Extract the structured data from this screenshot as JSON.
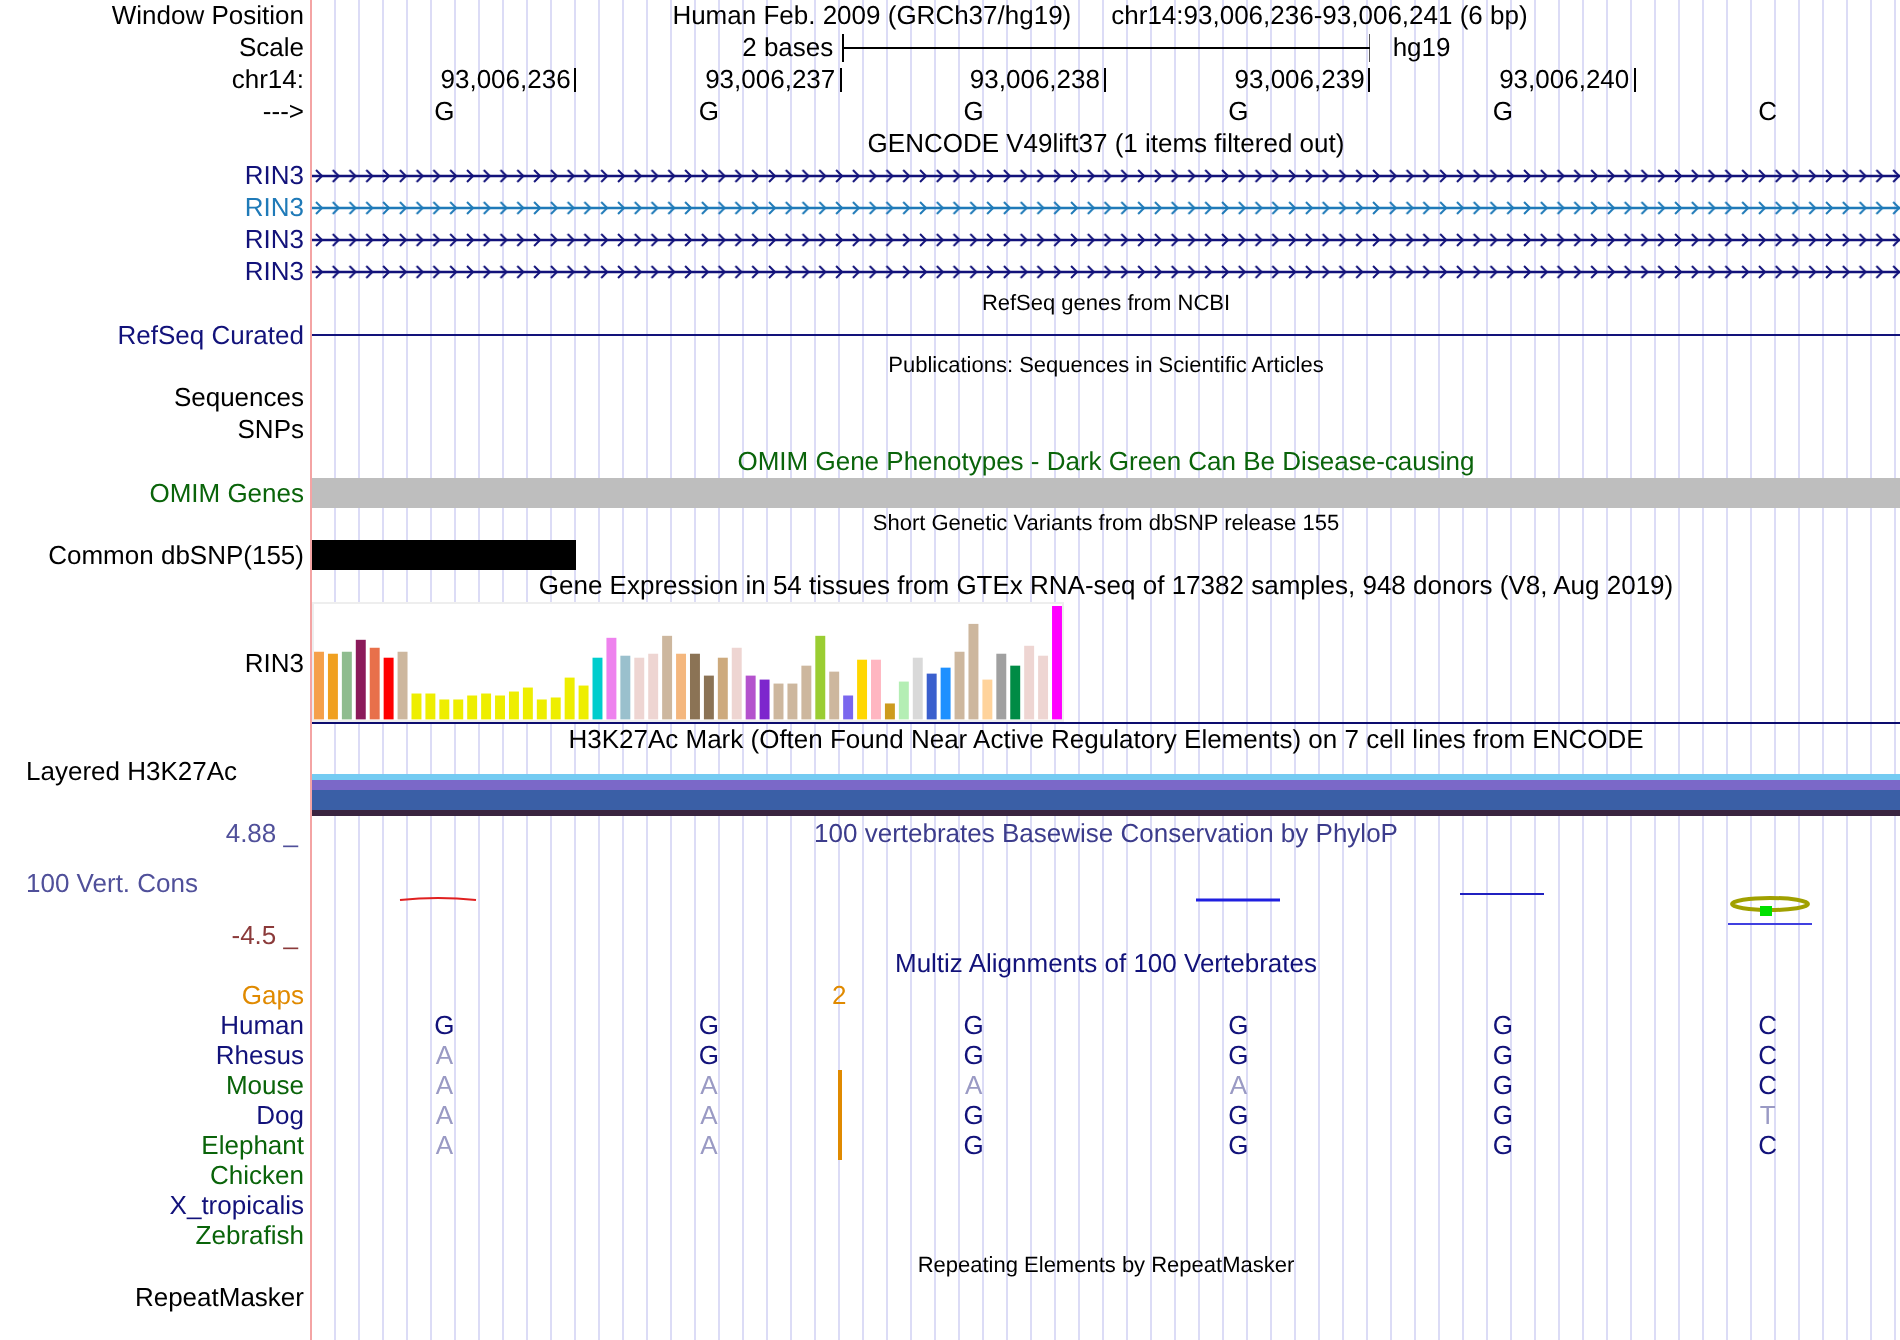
{
  "header": {
    "label": "Window Position",
    "assembly": "Human Feb. 2009 (GRCh37/hg19)",
    "position": "chr14:93,006,236-93,006,241 (6 bp)"
  },
  "scale": {
    "label": "Scale",
    "text": "2 bases",
    "assembly": "hg19"
  },
  "ruler": {
    "label": "chr14:",
    "ticks": [
      "93,006,236",
      "93,006,237",
      "93,006,238",
      "93,006,239",
      "93,006,240"
    ]
  },
  "bases": {
    "label": "--->",
    "values": [
      "G",
      "G",
      "G",
      "G",
      "G",
      "C"
    ]
  },
  "tracks": [
    {
      "kind": "title",
      "text": "GENCODE V49lift37 (1 items filtered out)",
      "color": "#000000"
    },
    {
      "kind": "gene",
      "label": "RIN3",
      "color": "#12127a"
    },
    {
      "kind": "gene",
      "label": "RIN3",
      "color": "#1f7ab8"
    },
    {
      "kind": "gene",
      "label": "RIN3",
      "color": "#12127a"
    },
    {
      "kind": "gene",
      "label": "RIN3",
      "color": "#12127a"
    },
    {
      "kind": "caption",
      "text": "RefSeq genes from NCBI"
    },
    {
      "kind": "line",
      "label": "RefSeq Curated",
      "color": "#12127a"
    },
    {
      "kind": "caption",
      "text": "Publications: Sequences in Scientific Articles"
    },
    {
      "kind": "label",
      "label": "Sequences"
    },
    {
      "kind": "label",
      "label": "SNPs"
    },
    {
      "kind": "title",
      "text": "OMIM Gene Phenotypes - Dark Green Can Be Disease-causing",
      "color": "#0a640a"
    },
    {
      "kind": "omim",
      "label": "OMIM Genes",
      "color": "#0a640a"
    },
    {
      "kind": "caption",
      "text": "Short Genetic Variants from dbSNP release 155"
    },
    {
      "kind": "snp",
      "label": "Common dbSNP(155)"
    },
    {
      "kind": "title",
      "text": "Gene Expression in 54 tissues from GTEx RNA-seq of 17382 samples, 948 donors (V8, Aug 2019)",
      "color": "#000000"
    },
    {
      "kind": "expression",
      "label": "RIN3"
    },
    {
      "kind": "title",
      "text": "H3K27Ac Mark (Often Found Near Active Regulatory Elements) on 7 cell lines from ENCODE",
      "color": "#000000"
    },
    {
      "kind": "layered",
      "label": "Layered H3K27Ac"
    },
    {
      "kind": "phylop",
      "top": "4.88 _",
      "label": "100 Vert. Cons",
      "bottom": "-4.5 _",
      "title": "100 vertebrates Basewise Conservation by PhyloP"
    },
    {
      "kind": "title",
      "text": "Multiz Alignments of 100 Vertebrates",
      "color": "#12127a"
    },
    {
      "kind": "gaps",
      "label": "Gaps",
      "value": "2"
    },
    {
      "kind": "species",
      "label": "Human",
      "color": "#12127a",
      "insertion": false,
      "bases": [
        {
          "base": "G",
          "match": true
        },
        {
          "base": "G",
          "match": true
        },
        {
          "base": "G",
          "match": true
        },
        {
          "base": "G",
          "match": true
        },
        {
          "base": "G",
          "match": true
        },
        {
          "base": "C",
          "match": true
        }
      ]
    },
    {
      "kind": "species",
      "label": "Rhesus",
      "color": "#12127a",
      "insertion": false,
      "bases": [
        {
          "base": "A",
          "match": false
        },
        {
          "base": "G",
          "match": true
        },
        {
          "base": "G",
          "match": true
        },
        {
          "base": "G",
          "match": true
        },
        {
          "base": "G",
          "match": true
        },
        {
          "base": "C",
          "match": true
        }
      ]
    },
    {
      "kind": "species",
      "label": "Mouse",
      "color": "#0a640a",
      "insertion": true,
      "bases": [
        {
          "base": "A",
          "match": false
        },
        {
          "base": "A",
          "match": false
        },
        {
          "base": "A",
          "match": false
        },
        {
          "base": "A",
          "match": false
        },
        {
          "base": "G",
          "match": true
        },
        {
          "base": "C",
          "match": true
        }
      ]
    },
    {
      "kind": "species",
      "label": "Dog",
      "color": "#12127a",
      "insertion": true,
      "bases": [
        {
          "base": "A",
          "match": false
        },
        {
          "base": "A",
          "match": false
        },
        {
          "base": "G",
          "match": true
        },
        {
          "base": "G",
          "match": true
        },
        {
          "base": "G",
          "match": true
        },
        {
          "base": "T",
          "match": false
        }
      ]
    },
    {
      "kind": "species",
      "label": "Elephant",
      "color": "#0a640a",
      "insertion": true,
      "bases": [
        {
          "base": "A",
          "match": false
        },
        {
          "base": "A",
          "match": false
        },
        {
          "base": "G",
          "match": true
        },
        {
          "base": "G",
          "match": true
        },
        {
          "base": "G",
          "match": true
        },
        {
          "base": "C",
          "match": true
        }
      ]
    },
    {
      "kind": "species",
      "label": "Chicken",
      "color": "#0a640a",
      "insertion": false
    },
    {
      "kind": "species",
      "label": "X_tropicalis",
      "color": "#12127a",
      "insertion": false
    },
    {
      "kind": "species",
      "label": "Zebrafish",
      "color": "#0a640a",
      "insertion": false
    },
    {
      "kind": "caption",
      "text": "Repeating Elements by RepeatMasker"
    },
    {
      "kind": "label",
      "label": "RepeatMasker"
    }
  ]
}
